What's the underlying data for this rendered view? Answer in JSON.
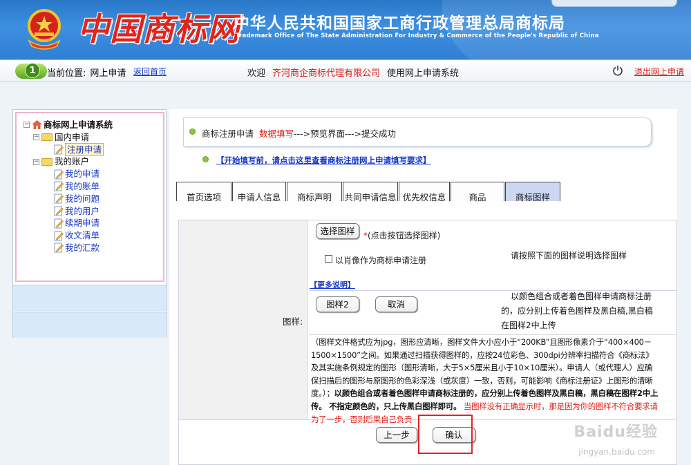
{
  "header": {
    "logo_text": "中国商标网",
    "org_name_cn": "中华人民共和国国家工商行政管理总局商标局",
    "org_name_en": "Trademark Office of The State Administration For Industry & Commerce of the People's Republic of China"
  },
  "navbar": {
    "step_number": "1",
    "location_label": "当前位置:",
    "location_value": "网上申请",
    "back_home": "返回首页",
    "welcome_prefix": "欢迎",
    "company": "齐河商企商标代理有限公司",
    "welcome_suffix": "使用网上申请系统",
    "logout": "退出网上申请"
  },
  "sidebar": {
    "root": "商标网上申请系统",
    "domestic": "国内申请",
    "register": "注册申请",
    "account": "我的账户",
    "items": [
      "我的申请",
      "我的账单",
      "我的问题",
      "我的用户",
      "续期申请",
      "收文清单",
      "我的汇款"
    ]
  },
  "steps": {
    "step1": "商标注册申请",
    "step2": "数据填写",
    "sep1": "--->",
    "step3": "预览界面",
    "sep2": "--->",
    "step4": "提交成功"
  },
  "notice": "【开始填写前，请点击这里查看商标注册网上申请填写要求】",
  "tabs": [
    "首页选项",
    "申请人信息",
    "商标声明",
    "共同申请信息",
    "优先权信息",
    "商品",
    "商标图样"
  ],
  "active_tab": "商标图样",
  "form": {
    "field_label": "图样:",
    "select_button": "选择图样",
    "asterisk": "*",
    "select_hint": "(点击按钮选择图样)",
    "portrait_label": "以肖像作为商标申请注册",
    "instruction_right": "请按照下面的图样说明选择图样",
    "more_link": "【更多说明】",
    "image2_button": "图样2",
    "cancel_button": "取消",
    "color_note_line1": "以颜色组合或者着色图样申请商标注册",
    "color_note_line2": "的，应分别上传着色图样及黑白稿,黑白稿",
    "color_note_line3": "在图样2中上传",
    "desc_part1": "（图样文件格式应为jpg，图形应清晰，图样文件大小应小于“200KB”且图形像素介于“400×400－1500×1500”之间。如果通过扫描获得图样的，应按24位彩色、300dpi分辨率扫描符合《商标法》及其实施条例规定的图形（图形清晰，大于5×5厘米且小于10×10厘米）。申请人（或代理人）应确保扫描后的图形与原图形的色彩深浅（或灰度）一致，否则，可能影响《商标注册证》上图形的清晰度。）；",
    "desc_bold": "以颜色组合或者着色图样申请商标注册的，应分别上传着色图样及黑白稿，黑白稿在图样2中上传。 不指定颜色的，只上传黑白图样即可。",
    "desc_red": "当图样没有正确显示时，那是因为你的图样不符合要求请为了一步，否则后果自己负责",
    "prev_button": "上一步",
    "confirm_button": "确认"
  },
  "watermark": {
    "main": "Baidu经验",
    "sub": "jingyan.baidu.com"
  },
  "colors": {
    "header_blue": "#2f7fd3",
    "accent_red": "#e01a12",
    "link_blue": "#1535c8",
    "active_tab": "#cbd7f3",
    "highlight": "#e4202a"
  }
}
